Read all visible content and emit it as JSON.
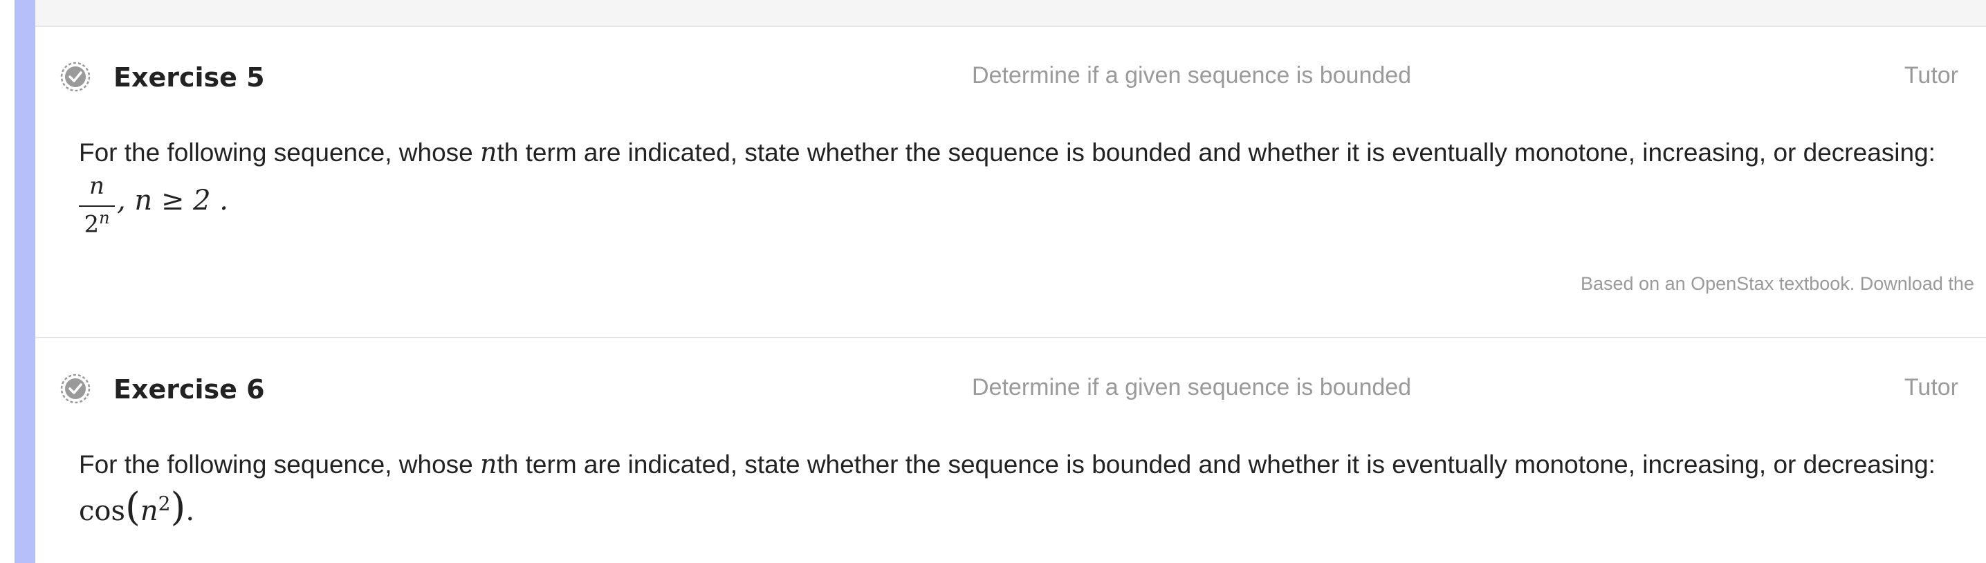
{
  "exercises": [
    {
      "title": "Exercise 5",
      "topic": "Determine if a given sequence is bounded",
      "tutor_label": "Tutor",
      "prompt_before_var": "For the following sequence, whose ",
      "prompt_var": "n",
      "prompt_after_var": "th  term are indicated, state whether the sequence is bounded and whether it is eventually monotone, increasing, or decreasing:",
      "math": {
        "numerator": "n",
        "denominator_base": "2",
        "denominator_exp": "n",
        "condition": ", n ≥ 2 ."
      },
      "attribution": "Based on an OpenStax textbook. Download the"
    },
    {
      "title": "Exercise 6",
      "topic": "Determine if a given sequence is bounded",
      "tutor_label": "Tutor",
      "prompt_before_var": "For the following sequence, whose ",
      "prompt_var": "n",
      "prompt_after_var": "th  term are indicated, state whether the sequence is bounded and whether it is eventually monotone, increasing, or decreasing:",
      "math": {
        "func": "cos",
        "arg_base": "n",
        "arg_exp": "2",
        "trailing": "."
      }
    }
  ],
  "colors": {
    "accent_rail": "#b7bffb",
    "muted_text": "#9a9a9a",
    "divider": "#e6e6e6",
    "check_icon": "#9a9a9a"
  },
  "icons": {
    "exercise_status": "check-circle-icon"
  }
}
